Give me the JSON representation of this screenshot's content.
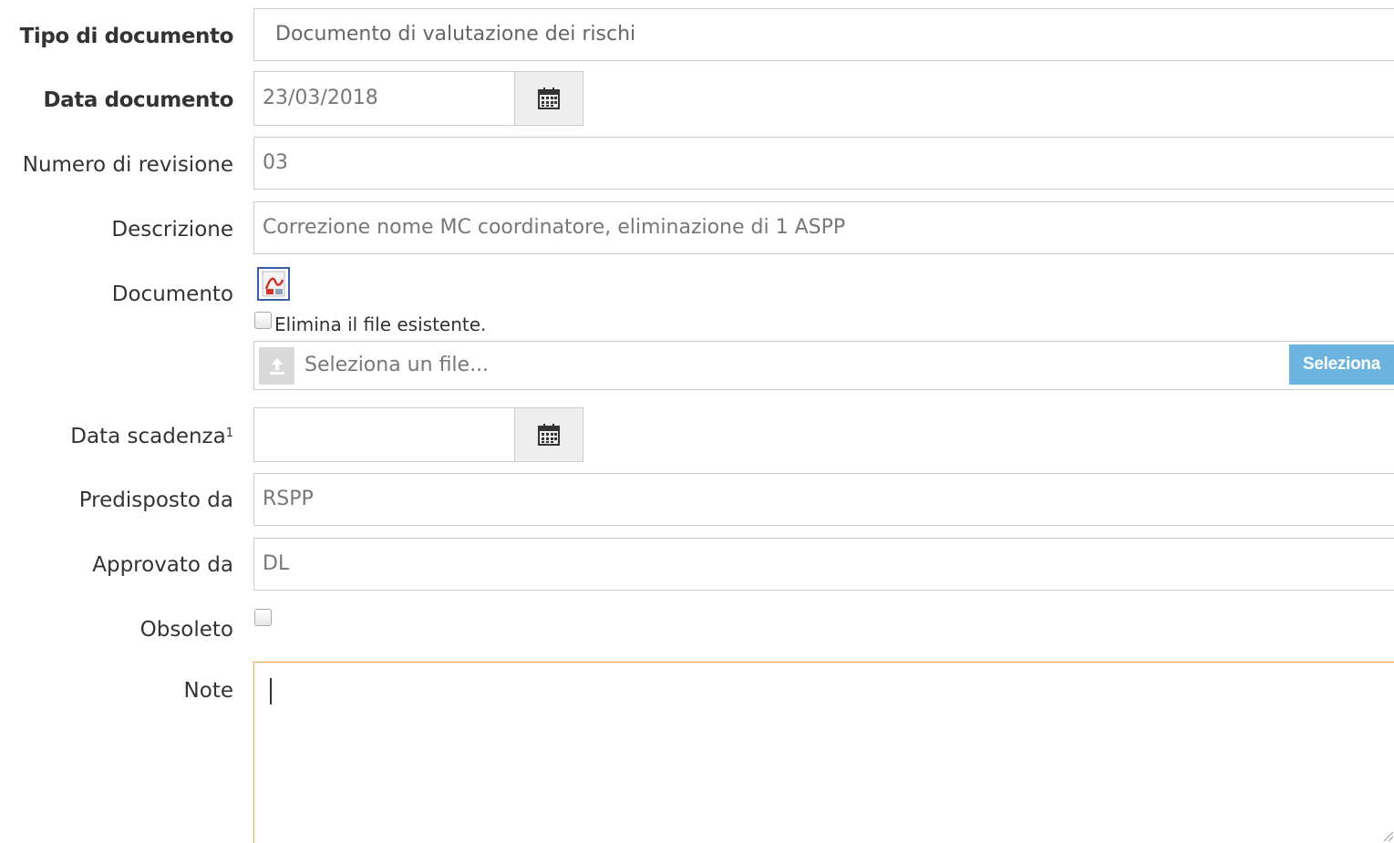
{
  "fields": {
    "tipo": {
      "label": "Tipo di documento",
      "value": "Documento di valutazione dei rischi"
    },
    "data_documento": {
      "label": "Data documento",
      "value": "23/03/2018"
    },
    "revisione": {
      "label": "Numero di revisione",
      "value": "03"
    },
    "descrizione": {
      "label": "Descrizione",
      "value": "Correzione nome MC coordinatore, eliminazione di 1 ASPP"
    },
    "documento": {
      "label": "Documento",
      "delete_checkbox_label": "Elimina il file esistente.",
      "delete_checked": false,
      "file_placeholder": "Seleziona un file...",
      "select_button": "Seleziona"
    },
    "data_scadenza": {
      "label": "Data scadenza",
      "footnote": "1",
      "value": ""
    },
    "predisposto": {
      "label": "Predisposto da",
      "value": "RSPP"
    },
    "approvato": {
      "label": "Approvato da",
      "value": "DL"
    },
    "obsoleto": {
      "label": "Obsoleto",
      "checked": false
    },
    "note": {
      "label": "Note",
      "value": ""
    }
  },
  "icons": {
    "calendar": "calendar-icon",
    "pdf": "pdf-file-icon",
    "upload": "upload-icon"
  },
  "colors": {
    "focus_border": "#f0a048",
    "select_button": "#6cb4e0",
    "addon_bg": "#eeeeee",
    "input_border": "#cccccc"
  }
}
